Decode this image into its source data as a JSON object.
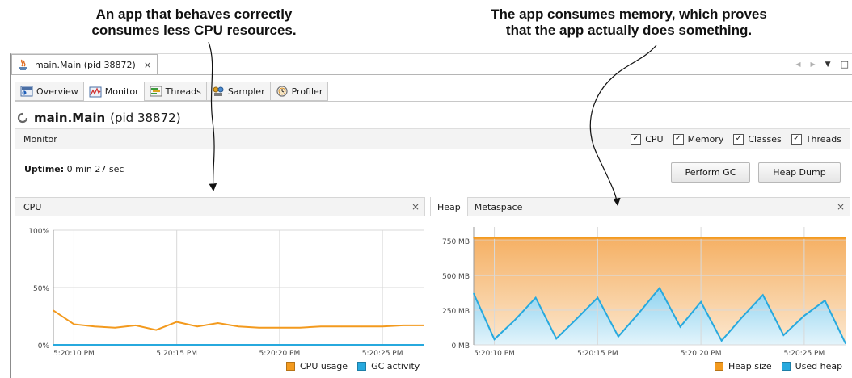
{
  "annotations": {
    "left": [
      "An app that behaves correctly",
      "consumes less CPU resources."
    ],
    "right": [
      "The app consumes memory, which proves",
      "that the app actually does something."
    ]
  },
  "window": {
    "tab_label": "main.Main (pid 38872)",
    "tab_close": "×",
    "controls": [
      "◀",
      "▶",
      "▼",
      "□"
    ]
  },
  "subtabs": [
    {
      "label": "Overview",
      "icon": "overview-icon"
    },
    {
      "label": "Monitor",
      "icon": "monitor-icon"
    },
    {
      "label": "Threads",
      "icon": "threads-icon"
    },
    {
      "label": "Sampler",
      "icon": "sampler-icon"
    },
    {
      "label": "Profiler",
      "icon": "profiler-icon"
    }
  ],
  "process": {
    "name": "main.Main",
    "pid": "(pid 38872)"
  },
  "monitor": {
    "label": "Monitor",
    "checkboxes": [
      {
        "label": "CPU",
        "checked": true
      },
      {
        "label": "Memory",
        "checked": true
      },
      {
        "label": "Classes",
        "checked": true
      },
      {
        "label": "Threads",
        "checked": true
      }
    ],
    "uptime_label": "Uptime:",
    "uptime_value": "0 min 27 sec",
    "perform_gc": "Perform GC",
    "heap_dump": "Heap Dump"
  },
  "cpu_panel": {
    "title": "CPU",
    "close": "×",
    "legend": [
      "CPU usage",
      "GC activity"
    ]
  },
  "heap_panel": {
    "tabs": [
      "Heap",
      "Metaspace"
    ],
    "close": "×",
    "legend": [
      "Heap size",
      "Used heap"
    ]
  },
  "colors": {
    "orange": "#F39A1E",
    "orange_fill": "#FBDDB6",
    "blue": "#27A9DE",
    "blue_fill": "#D4EEF9",
    "grid": "#D9D9D9"
  },
  "chart_data": [
    {
      "type": "line",
      "title": "CPU",
      "x": [
        "5:20:09",
        "5:20:10",
        "5:20:11",
        "5:20:12",
        "5:20:13",
        "5:20:14",
        "5:20:15",
        "5:20:16",
        "5:20:17",
        "5:20:18",
        "5:20:19",
        "5:20:20",
        "5:20:21",
        "5:20:22",
        "5:20:23",
        "5:20:24",
        "5:20:25",
        "5:20:26",
        "5:20:27"
      ],
      "x_ticks": [
        "5:20:10 PM",
        "5:20:15 PM",
        "5:20:20 PM",
        "5:20:25 PM"
      ],
      "y_ticks": [
        "0%",
        "50%",
        "100%"
      ],
      "ylim": [
        0,
        100
      ],
      "grid": true,
      "legend": "bottom-right",
      "series": [
        {
          "name": "CPU usage",
          "color": "#F39A1E",
          "values": [
            30,
            18,
            16,
            15,
            17,
            13,
            20,
            16,
            19,
            16,
            15,
            15,
            15,
            16,
            16,
            16,
            16,
            17,
            17
          ]
        },
        {
          "name": "GC activity",
          "color": "#27A9DE",
          "values": [
            0,
            0,
            0,
            0,
            0,
            0,
            0,
            0,
            0,
            0,
            0,
            0,
            0,
            0,
            0,
            0,
            0,
            0,
            0
          ]
        }
      ]
    },
    {
      "type": "area",
      "title": "Heap",
      "x": [
        "5:20:09",
        "5:20:10",
        "5:20:11",
        "5:20:12",
        "5:20:13",
        "5:20:14",
        "5:20:15",
        "5:20:16",
        "5:20:17",
        "5:20:18",
        "5:20:19",
        "5:20:20",
        "5:20:21",
        "5:20:22",
        "5:20:23",
        "5:20:24",
        "5:20:25",
        "5:20:26",
        "5:20:27"
      ],
      "x_ticks": [
        "5:20:10 PM",
        "5:20:15 PM",
        "5:20:20 PM",
        "5:20:25 PM"
      ],
      "y_ticks": [
        "0 MB",
        "250 MB",
        "500 MB",
        "750 MB"
      ],
      "ylim": [
        0,
        850
      ],
      "grid": true,
      "legend": "bottom-right",
      "series": [
        {
          "name": "Heap size",
          "color": "#F39A1E",
          "values": [
            770,
            770,
            770,
            770,
            770,
            770,
            770,
            770,
            770,
            770,
            770,
            770,
            770,
            770,
            770,
            770,
            770,
            770,
            770
          ]
        },
        {
          "name": "Used heap",
          "color": "#27A9DE",
          "values": [
            370,
            40,
            180,
            340,
            45,
            190,
            340,
            60,
            230,
            410,
            130,
            310,
            30,
            200,
            360,
            70,
            210,
            320,
            10
          ]
        }
      ]
    }
  ]
}
